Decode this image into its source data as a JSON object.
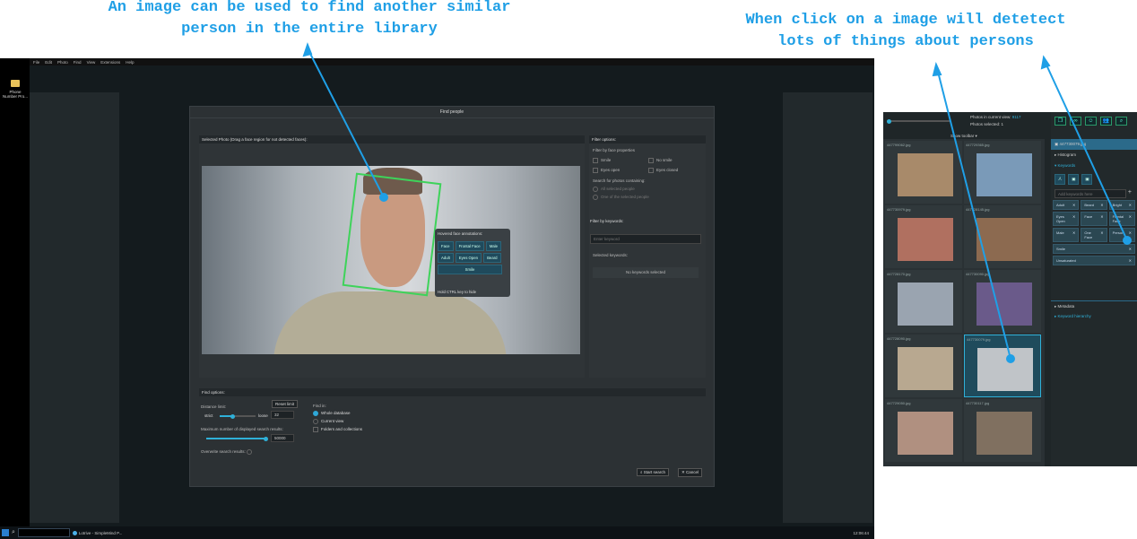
{
  "annotations": {
    "left": "An image can be used to find another similar\nperson in the entire library",
    "right": "When click on a image will detetect\nlots of things about persons"
  },
  "desktop": {
    "icon_label": "Phone Number Pro..."
  },
  "menu": [
    "File",
    "Edit",
    "Photo",
    "Find",
    "View",
    "Extensions",
    "Help"
  ],
  "taskbar": {
    "task": "Lotrive - SimpleMind P...",
    "clock": "12:06:44"
  },
  "dialog": {
    "title": "Find people",
    "selected_photo_label": "Selected Photo (Drag a face region for not detected faces):",
    "hover": {
      "title": "Hovered face annotations:",
      "chips": [
        "Face",
        "Frontal Face",
        "Male",
        "Adult",
        "Eyes Open",
        "Beard",
        "Smile"
      ],
      "hint": "Hold CTRL key to hide"
    },
    "filter": {
      "title": "Filter options:",
      "face_props": "Filter by face properties",
      "smile": "Smile",
      "no_smile": "No smile",
      "eyes_open": "Eyes open",
      "eyes_closed": "Eyes closed",
      "search_for": "Search for photos containing:",
      "all": "All selected people",
      "one": "One of the selected people",
      "kw_title": "Filter by keywords:",
      "kw_placeholder": "Enter keyword",
      "selected_kw": "Selected keywords:",
      "no_kw": "No keywords selected"
    },
    "find": {
      "title": "Find options:",
      "distance": "Distance limit:",
      "reset": "Reset limit",
      "strict": "strict",
      "loose": "loose",
      "distance_value": "32",
      "max_label": "Maximum number of displayed search results:",
      "max_value": "50000",
      "overwrite": "Overwrite search results:",
      "find_in": "Find in:",
      "whole": "Whole database",
      "current": "Current view",
      "folders": "Folders and collections",
      "distance_pct": 35,
      "max_pct": 100
    },
    "start": "Start search",
    "cancel": "Cancel"
  },
  "inset": {
    "photos_in_view": "Photos in current view:",
    "photos_in_view_value": "9117",
    "photos_selected": "Photos selected:",
    "photos_selected_value": "1",
    "show_toolbar": "Show toolbar",
    "files": [
      "447799062.jpg",
      "447729365.jpg",
      "447730979.jpg",
      "447728145.jpg",
      "447728170.jpg",
      "447730090.jpg",
      "447728090.jpg",
      "447730079.jpg",
      "447729050.jpg",
      "447730117.jpg"
    ],
    "selected_file": "447730079.jpg",
    "panel": {
      "file": "447730079.jpg",
      "histogram": "Histogram",
      "keywords": "Keywords",
      "add_placeholder": "Add keywords here",
      "chips": [
        "Adult",
        "Beard",
        "Bright",
        "Eyes Open",
        "Face",
        "Frontal Face",
        "Male",
        "One Face",
        "Person",
        "Smile",
        "Unsaturated"
      ],
      "metadata": "Metadata",
      "hierarchy": "Keyword hierarchy"
    }
  }
}
